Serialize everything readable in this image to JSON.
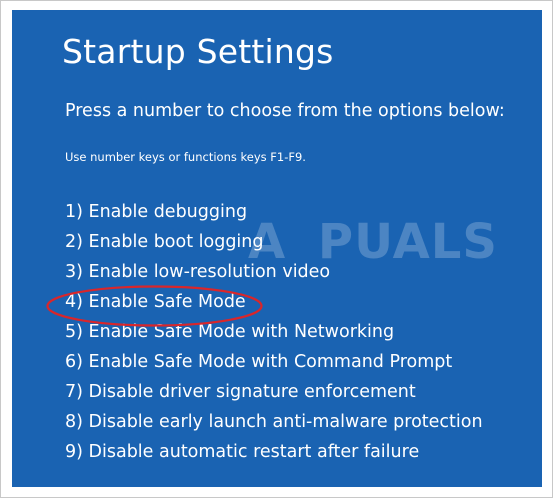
{
  "screen": {
    "title": "Startup Settings",
    "subtitle": "Press a number to choose from the options below:",
    "hint": "Use number keys or functions keys F1-F9.",
    "options": [
      {
        "label": "1) Enable debugging"
      },
      {
        "label": "2) Enable boot logging"
      },
      {
        "label": "3) Enable low-resolution video"
      },
      {
        "label": "4) Enable Safe Mode"
      },
      {
        "label": "5) Enable Safe Mode with Networking"
      },
      {
        "label": "6) Enable Safe Mode with Command Prompt"
      },
      {
        "label": "7) Disable driver signature enforcement"
      },
      {
        "label": "8) Disable early launch anti-malware protection"
      },
      {
        "label": "9) Disable automatic restart after failure"
      }
    ]
  },
  "watermark": "APPUALS",
  "colors": {
    "background": "#1a63b2",
    "text": "#ffffff",
    "highlight": "#d9262b"
  }
}
